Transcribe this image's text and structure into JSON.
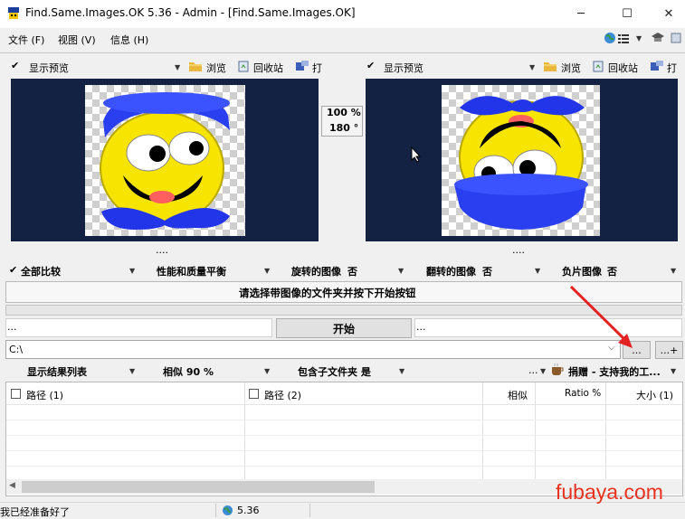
{
  "window": {
    "title": "Find.Same.Images.OK 5.36 - Admin - [Find.Same.Images.OK]",
    "minimize": "─",
    "maximize": "☐",
    "close": "✕"
  },
  "menu": [
    "文件 (F)",
    "视图 (V)",
    "信息 (H)"
  ],
  "left_toolbar": {
    "preview": "显示预览",
    "browse": "浏览",
    "recycle": "回收站",
    "more": "打"
  },
  "right_toolbar": {
    "preview": "显示预览",
    "browse": "浏览",
    "recycle": "回收站",
    "more": "打"
  },
  "comparison": {
    "percent": "100 %",
    "angle": "180 °"
  },
  "left_caption": "....",
  "right_caption": "....",
  "options": {
    "compare_all": "全部比较",
    "balance": "性能和质量平衡",
    "rotated_label": "旋转的图像",
    "rotated_value": "否",
    "flipped_label": "翻转的图像",
    "flipped_value": "否",
    "negative_label": "负片图像",
    "negative_value": "否"
  },
  "instruction": "请选择带图像的文件夹并按下开始按钮",
  "left_field": "...",
  "start_button": "开始",
  "right_field": "...",
  "path": {
    "value": "C:\\",
    "browse": "...",
    "add": "...+"
  },
  "results": {
    "display": "显示结果列表",
    "similarity": "相似 90 %",
    "subfolders": "包含子文件夹 是",
    "ellipsis": "...",
    "donate": "捐赠 - 支持我的工..."
  },
  "columns": [
    "路径 (1)",
    "路径 (2)",
    "相似",
    "Ratio %",
    "大小 (1)"
  ],
  "status": {
    "text": "我已经准备好了",
    "version": "5.36"
  },
  "watermark": "fubaya.com",
  "colors": {
    "accent_dark": "#132243",
    "watermark": "#e8311f",
    "arrow": "#e32222"
  }
}
